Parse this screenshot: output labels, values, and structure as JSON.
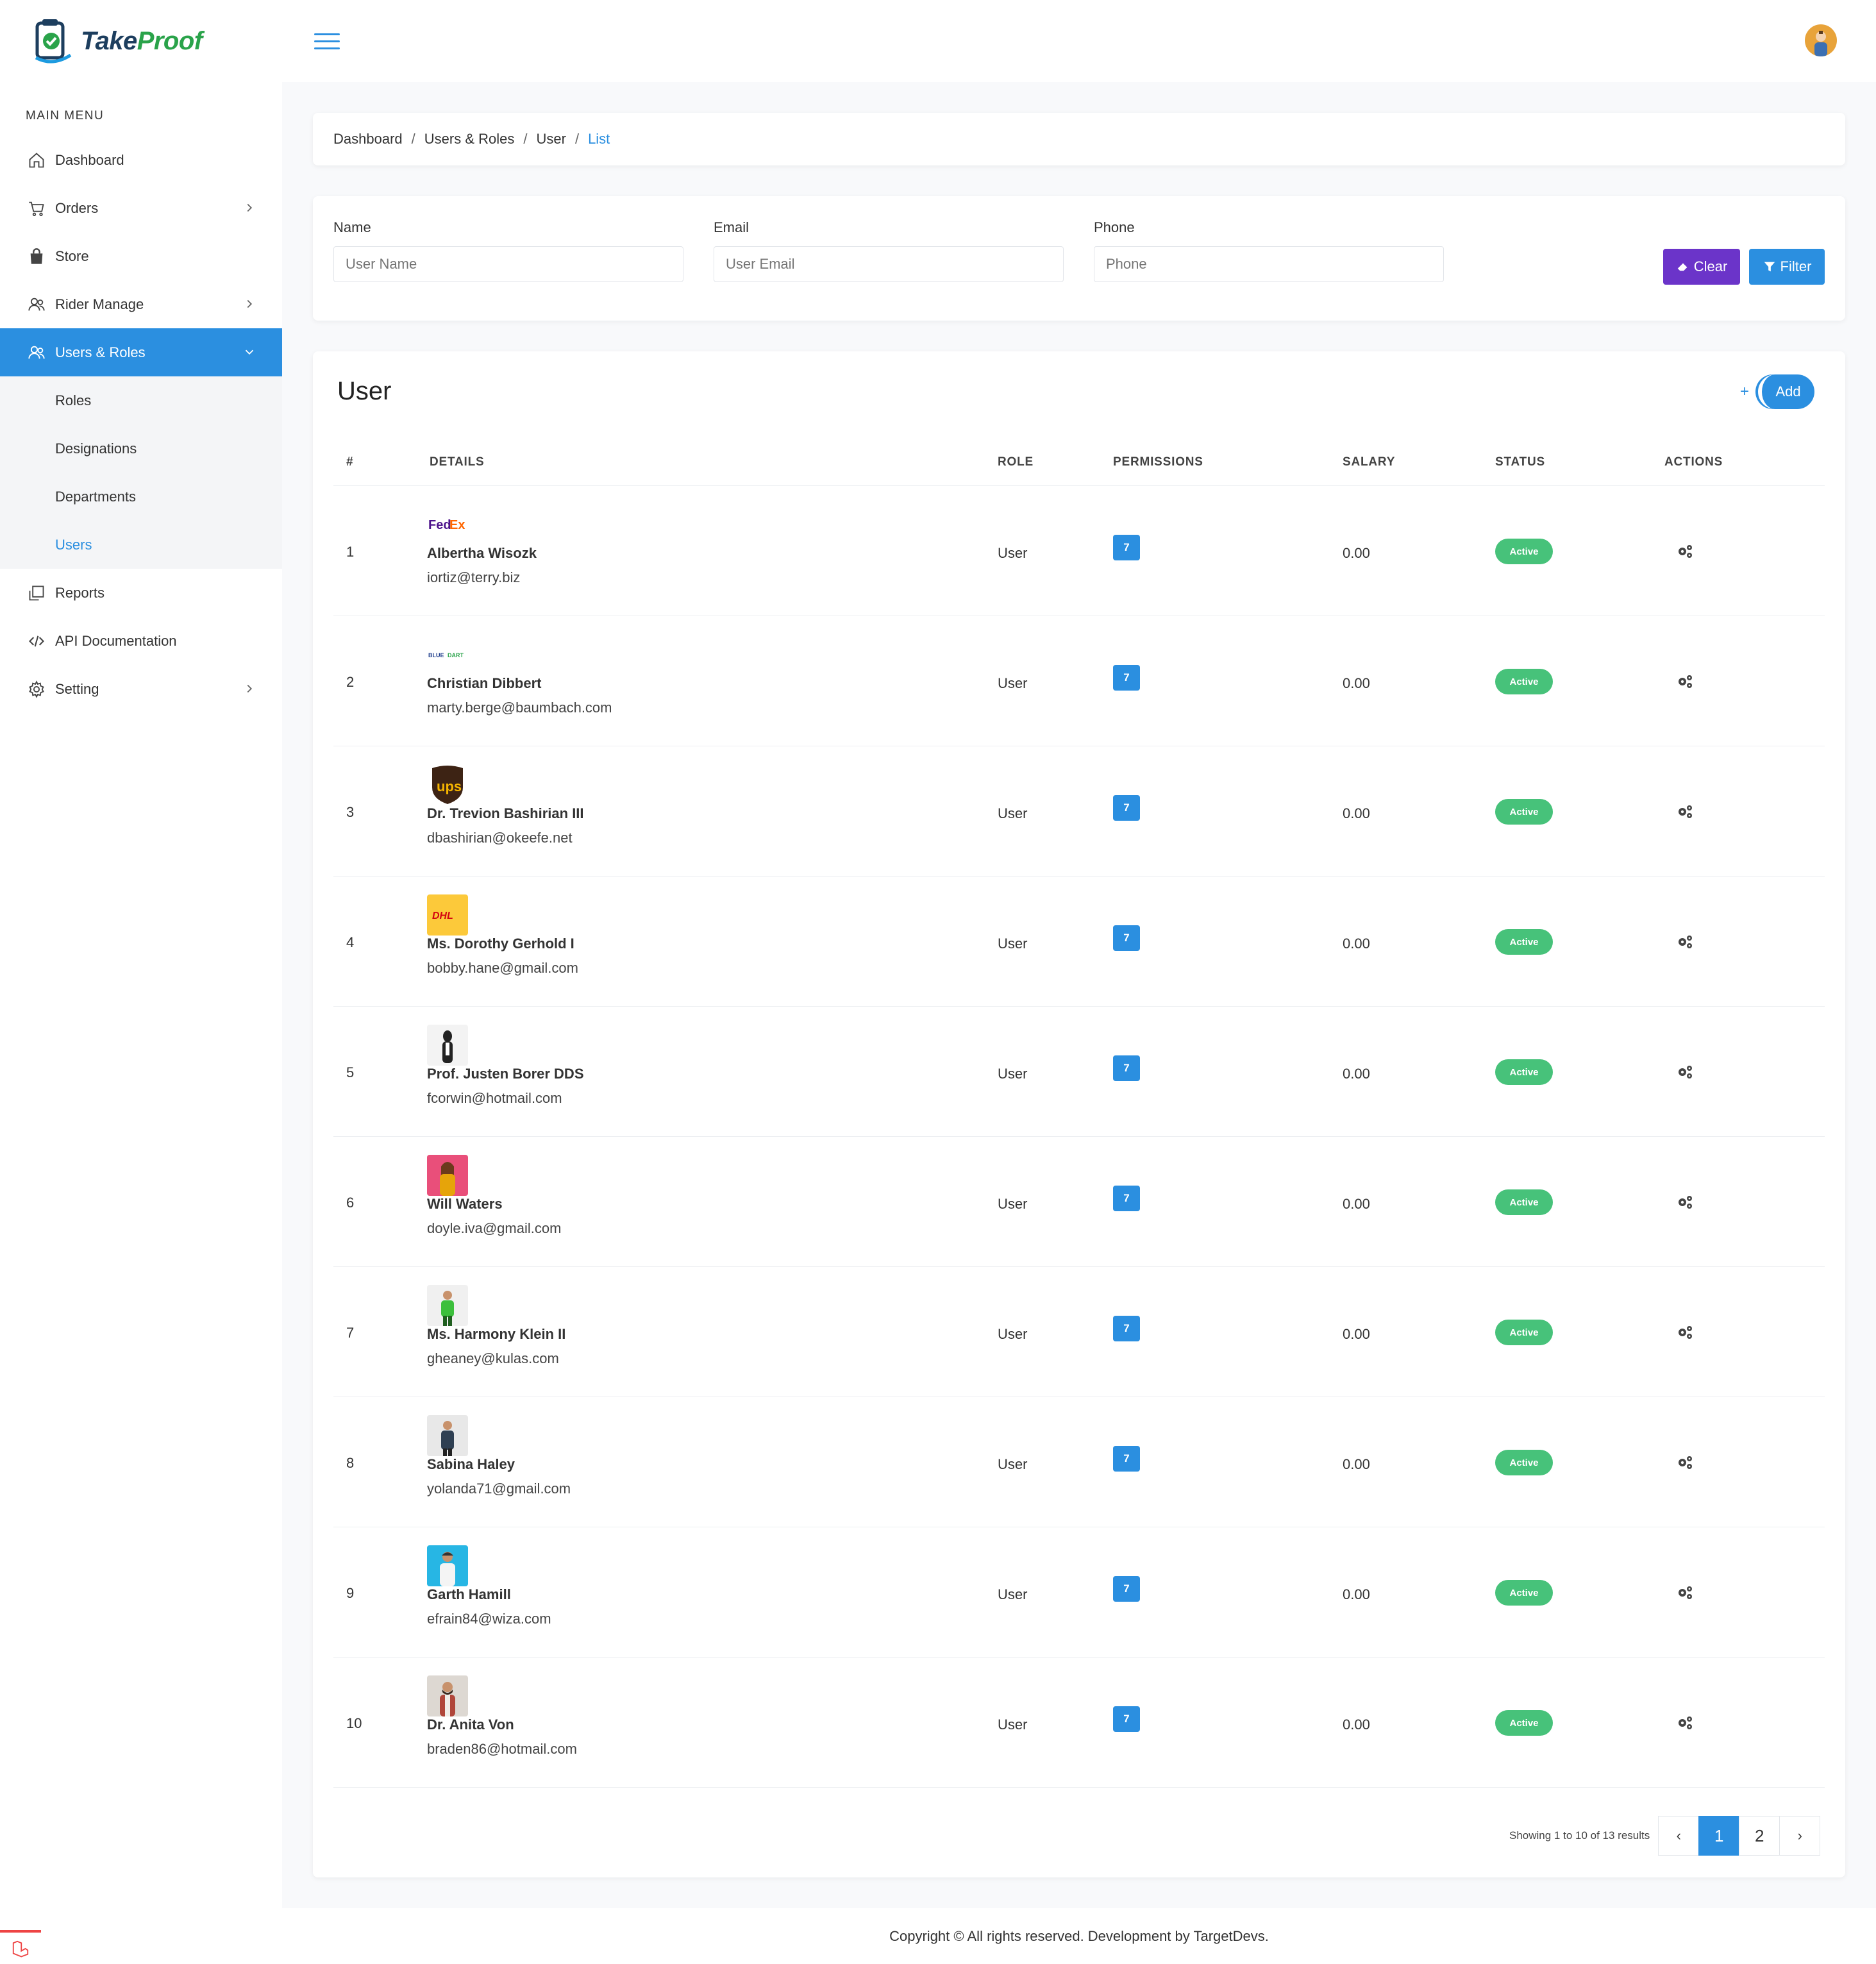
{
  "brand": {
    "name_part1": "Take",
    "name_part2": "Proof"
  },
  "sidebar": {
    "section_title": "MAIN MENU",
    "items": [
      {
        "label": "Dashboard",
        "icon": "home-icon",
        "has_children": false
      },
      {
        "label": "Orders",
        "icon": "cart-icon",
        "has_children": true
      },
      {
        "label": "Store",
        "icon": "store-icon",
        "has_children": false
      },
      {
        "label": "Rider Manage",
        "icon": "users-icon",
        "has_children": true
      },
      {
        "label": "Users & Roles",
        "icon": "users-icon",
        "has_children": true,
        "active": true
      },
      {
        "label": "Reports",
        "icon": "reports-icon",
        "has_children": false
      },
      {
        "label": "API Documentation",
        "icon": "code-icon",
        "has_children": false
      },
      {
        "label": "Setting",
        "icon": "gear-icon",
        "has_children": true
      }
    ],
    "submenu": [
      {
        "label": "Roles"
      },
      {
        "label": "Designations"
      },
      {
        "label": "Departments"
      },
      {
        "label": "Users",
        "current": true
      }
    ]
  },
  "breadcrumb": [
    "Dashboard",
    "Users & Roles",
    "User",
    "List"
  ],
  "filters": {
    "name_label": "Name",
    "name_placeholder": "User Name",
    "email_label": "Email",
    "email_placeholder": "User Email",
    "phone_label": "Phone",
    "phone_placeholder": "Phone",
    "clear_label": "Clear",
    "filter_label": "Filter"
  },
  "table": {
    "title": "User",
    "add_plus": "+",
    "add_label": "Add",
    "headers": [
      "#",
      "DETAILS",
      "ROLE",
      "PERMISSIONS",
      "SALARY",
      "STATUS",
      "ACTIONS"
    ],
    "rows": [
      {
        "num": "1",
        "logo": "fedex",
        "name": "Albertha Wisozk",
        "email": "iortiz@terry.biz",
        "role": "User",
        "permissions": "7",
        "salary": "0.00",
        "status": "Active"
      },
      {
        "num": "2",
        "logo": "bluedart",
        "name": "Christian Dibbert",
        "email": "marty.berge@baumbach.com",
        "role": "User",
        "permissions": "7",
        "salary": "0.00",
        "status": "Active"
      },
      {
        "num": "3",
        "logo": "ups",
        "name": "Dr. Trevion Bashirian III",
        "email": "dbashirian@okeefe.net",
        "role": "User",
        "permissions": "7",
        "salary": "0.00",
        "status": "Active"
      },
      {
        "num": "4",
        "logo": "dhl",
        "name": "Ms. Dorothy Gerhold I",
        "email": "bobby.hane@gmail.com",
        "role": "User",
        "permissions": "7",
        "salary": "0.00",
        "status": "Active"
      },
      {
        "num": "5",
        "logo": "photo-white",
        "name": "Prof. Justen Borer DDS",
        "email": "fcorwin@hotmail.com",
        "role": "User",
        "permissions": "7",
        "salary": "0.00",
        "status": "Active"
      },
      {
        "num": "6",
        "logo": "photo-pink",
        "name": "Will Waters",
        "email": "doyle.iva@gmail.com",
        "role": "User",
        "permissions": "7",
        "salary": "0.00",
        "status": "Active"
      },
      {
        "num": "7",
        "logo": "photo-green",
        "name": "Ms. Harmony Klein II",
        "email": "gheaney@kulas.com",
        "role": "User",
        "permissions": "7",
        "salary": "0.00",
        "status": "Active"
      },
      {
        "num": "8",
        "logo": "photo-grey",
        "name": "Sabina Haley",
        "email": "yolanda71@gmail.com",
        "role": "User",
        "permissions": "7",
        "salary": "0.00",
        "status": "Active"
      },
      {
        "num": "9",
        "logo": "photo-cyan",
        "name": "Garth Hamill",
        "email": "efrain84@wiza.com",
        "role": "User",
        "permissions": "7",
        "salary": "0.00",
        "status": "Active"
      },
      {
        "num": "10",
        "logo": "photo-brick",
        "name": "Dr. Anita Von",
        "email": "braden86@hotmail.com",
        "role": "User",
        "permissions": "7",
        "salary": "0.00",
        "status": "Active"
      }
    ]
  },
  "pagination": {
    "info": "Showing 1 to 10 of 13 results",
    "prev": "‹",
    "pages": [
      "1",
      "2"
    ],
    "current": "1",
    "next": "›"
  },
  "footer": "Copyright © All rights reserved. Development by TargetDevs.",
  "colors": {
    "primary": "#2b8fe0",
    "clear_button": "#6b34c9",
    "status_active": "#47c27a"
  }
}
